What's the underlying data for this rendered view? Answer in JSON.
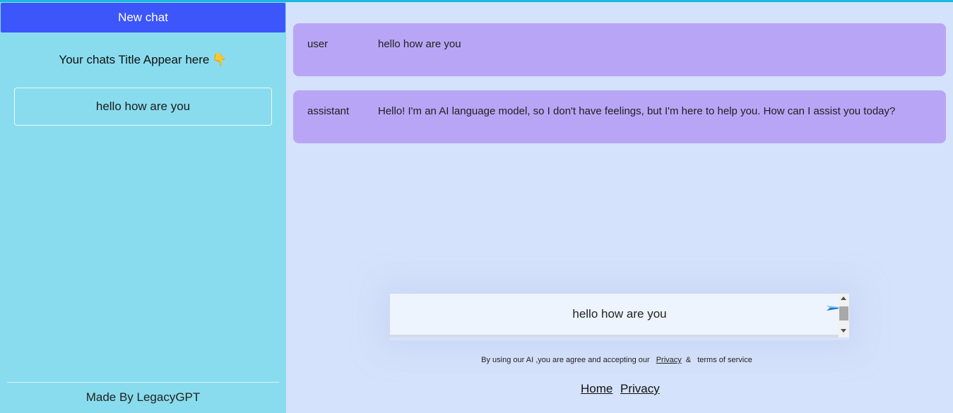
{
  "sidebar": {
    "new_chat_label": "New chat",
    "chats_title": "Your chats Title Appear here",
    "chats_title_icon": "👇",
    "chat_items": [
      {
        "label": "hello how are you"
      }
    ],
    "made_by": "Made By LegacyGPT"
  },
  "messages": [
    {
      "role": "user",
      "content": "hello how are you"
    },
    {
      "role": "assistant",
      "content": "Hello! I'm an AI language model, so I don't have feelings, but I'm here to help you. How can I assist you today?"
    }
  ],
  "input": {
    "value": "hello how are you",
    "send_icon": "paper-plane-icon"
  },
  "disclaimer": {
    "text": "By using our AI ,you are agree and accepting our",
    "privacy_link": "Privacy",
    "ampersand": "&",
    "terms_text": "terms of service"
  },
  "footer": {
    "home_link": "Home",
    "privacy_link": "Privacy"
  },
  "colors": {
    "accent": "#3c56fb",
    "sidebar_bg": "#89dcee",
    "main_bg": "#d5e2fb",
    "message_bg": "#b9a5f6",
    "top_line": "#1cb8e0"
  }
}
